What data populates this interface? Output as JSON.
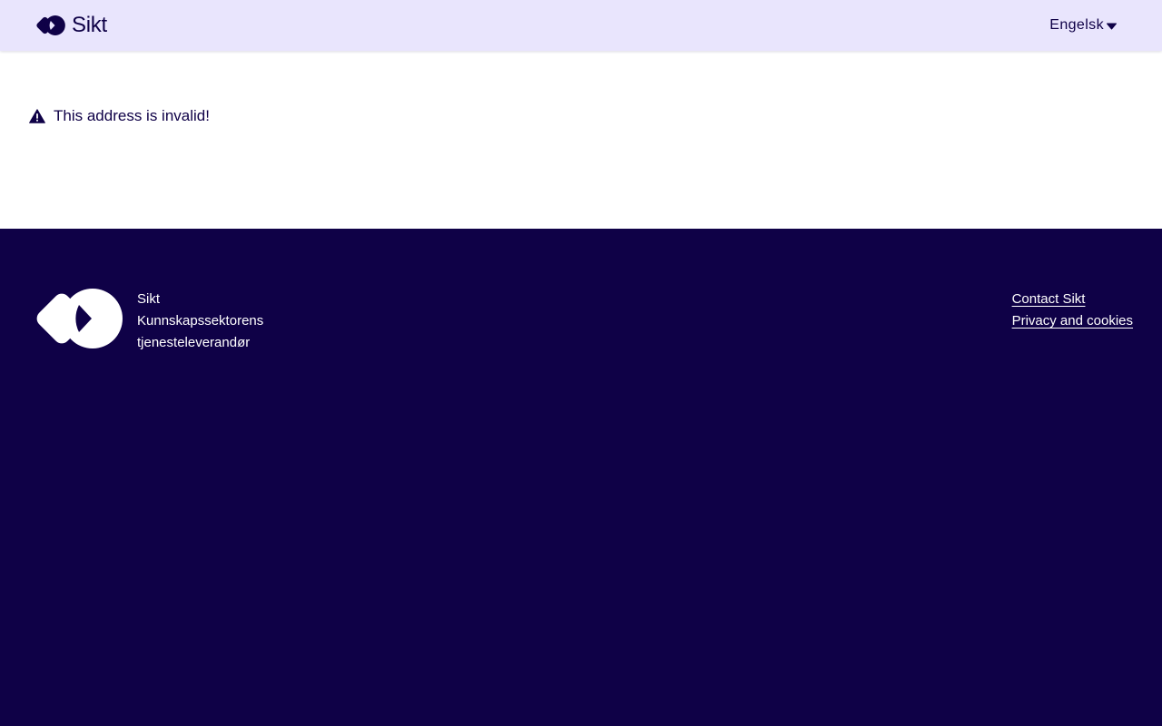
{
  "header": {
    "brand_name": "Sikt",
    "language_label": "Engelsk",
    "logo_icon": "sikt-logo-icon",
    "caret_icon": "caret-down-icon"
  },
  "main": {
    "alert_icon": "warning-icon",
    "alert_text": "This address is invalid!"
  },
  "footer": {
    "brand_lines": [
      "Sikt",
      "Kunnskapssektorens",
      "tjenesteleverandør"
    ],
    "links": [
      {
        "label": "Contact Sikt"
      },
      {
        "label": "Privacy and cookies"
      }
    ]
  },
  "colors": {
    "header_bg": "#e9e5fd",
    "brand_dark": "#0f0147",
    "content_bg": "#ffffff",
    "footer_bg": "#0f0147",
    "footer_text": "#ffffff"
  }
}
